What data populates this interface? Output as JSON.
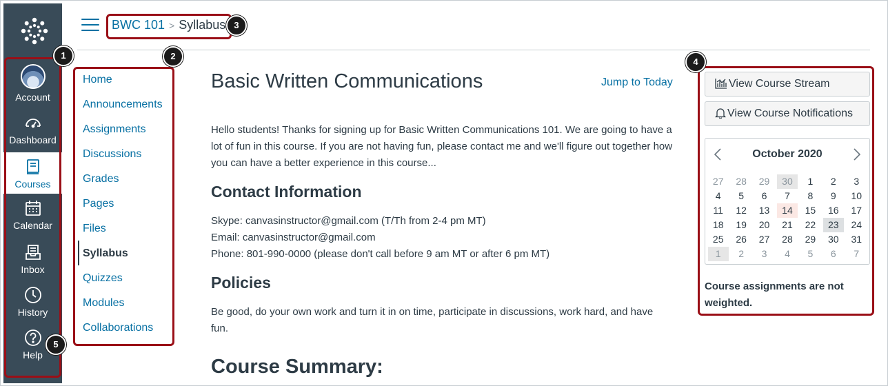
{
  "global_nav": {
    "items": [
      {
        "label": "Account",
        "icon": "avatar"
      },
      {
        "label": "Dashboard",
        "icon": "dashboard-icon"
      },
      {
        "label": "Courses",
        "icon": "courses-icon",
        "active": true
      },
      {
        "label": "Calendar",
        "icon": "calendar-icon"
      },
      {
        "label": "Inbox",
        "icon": "inbox-icon"
      },
      {
        "label": "History",
        "icon": "history-icon"
      },
      {
        "label": "Help",
        "icon": "help-icon"
      }
    ]
  },
  "breadcrumb": {
    "course": "BWC 101",
    "separator": ">",
    "current": "Syllabus"
  },
  "course_nav": {
    "items": [
      "Home",
      "Announcements",
      "Assignments",
      "Discussions",
      "Grades",
      "Pages",
      "Files",
      "Syllabus",
      "Quizzes",
      "Modules",
      "Collaborations"
    ],
    "active": "Syllabus"
  },
  "content": {
    "title": "Basic Written Communications",
    "jump_to_today": "Jump to Today",
    "intro": "Hello students! Thanks for signing up for Basic Written Communications 101. We are going to have a lot of fun in this course. If you are not having fun, please contact me and we'll figure out together how you can have a better experience in this course...",
    "contact_heading": "Contact Information",
    "contact_lines": [
      "Skype: canvasinstructor@gmail.com (T/Th from 2-4 pm MT)",
      "Email: canvasinstructor@gmail.com",
      "Phone: 801-990-0000 (please don't call before 9 am MT or after 6 pm MT)"
    ],
    "policies_heading": "Policies",
    "policies_text": "Be good, do your own work and turn it in on time, participate in discussions, work hard, and have fun.",
    "summary_heading": "Course Summary:"
  },
  "sidebar": {
    "stream_button": "View Course Stream",
    "notifications_button": "View Course Notifications",
    "calendar": {
      "month_label": "October 2020",
      "weeks": [
        [
          "27",
          "28",
          "29",
          "30",
          "1",
          "2",
          "3"
        ],
        [
          "4",
          "5",
          "6",
          "7",
          "8",
          "9",
          "10"
        ],
        [
          "11",
          "12",
          "13",
          "14",
          "15",
          "16",
          "17"
        ],
        [
          "18",
          "19",
          "20",
          "21",
          "22",
          "23",
          "24"
        ],
        [
          "25",
          "26",
          "27",
          "28",
          "29",
          "30",
          "31"
        ],
        [
          "1",
          "2",
          "3",
          "4",
          "5",
          "6",
          "7"
        ]
      ],
      "today": "14",
      "selected": "23"
    },
    "weight_note": "Course assignments are not weighted."
  },
  "annotations": [
    "1",
    "2",
    "3",
    "4",
    "5"
  ],
  "colors": {
    "nav_bg": "#394b58",
    "link": "#0770a3",
    "annotation": "#9a0f17"
  }
}
